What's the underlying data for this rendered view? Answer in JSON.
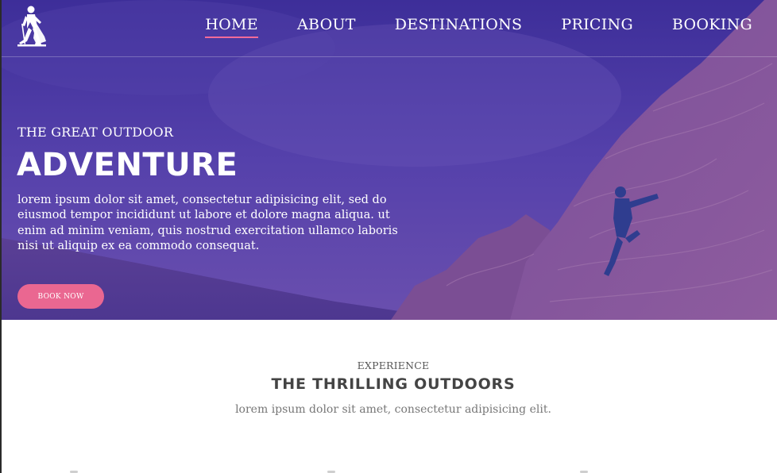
{
  "nav": {
    "logo_icon": "hiker-icon",
    "items": [
      {
        "label": "HOME",
        "active": true
      },
      {
        "label": "ABOUT",
        "active": false
      },
      {
        "label": "DESTINATIONS",
        "active": false
      },
      {
        "label": "PRICING",
        "active": false
      },
      {
        "label": "BOOKING",
        "active": false
      }
    ]
  },
  "hero": {
    "kicker": "THE GREAT OUTDOOR",
    "title": "ADVENTURE",
    "text": "lorem ipsum dolor sit amet, consectetur adipisicing elit, sed do eiusmod tempor incididunt ut labore et dolore magna aliqua. ut enim ad minim veniam, quis nostrud exercitation ullamco laboris nisi ut aliquip ex ea commodo consequat.",
    "button_label": "BOOK NOW"
  },
  "section": {
    "kicker": "EXPERIENCE",
    "title": "THE THRILLING OUTDOORS",
    "text": "lorem ipsum dolor sit amet, consectetur adipisicing elit."
  },
  "colors": {
    "hero_overlay": "#4a37a6",
    "accent": "#ea6791",
    "heading": "#444444"
  }
}
